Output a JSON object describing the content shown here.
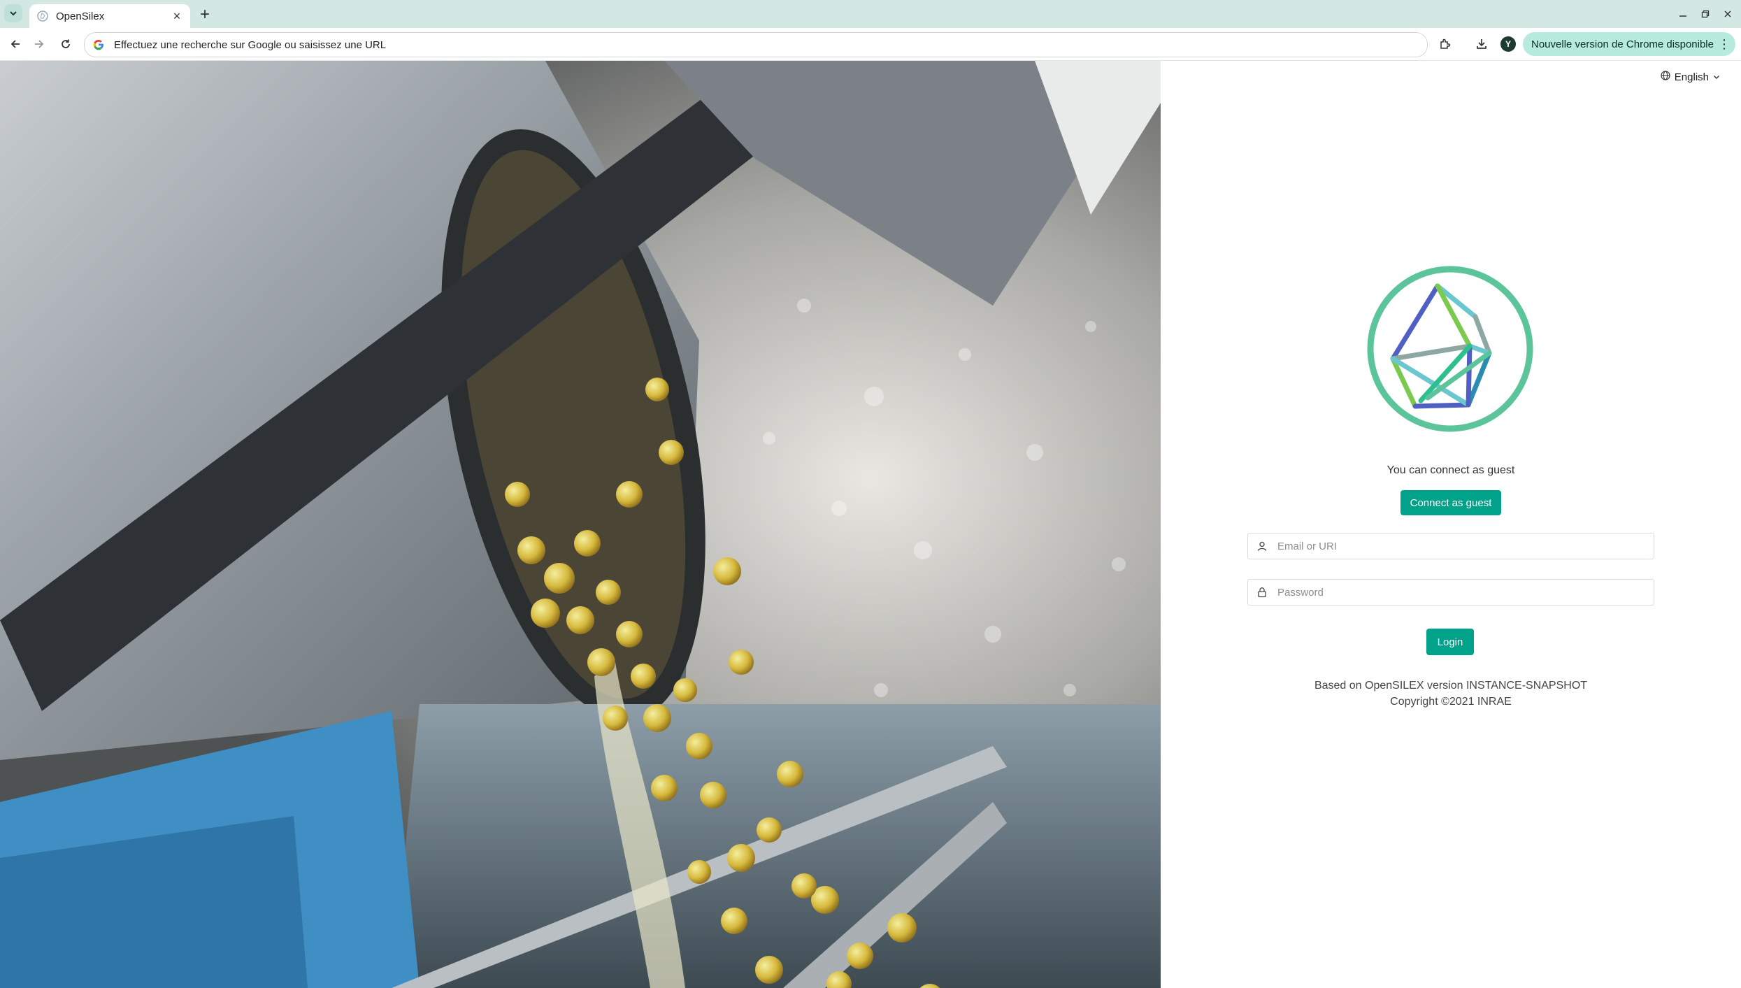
{
  "browser": {
    "tab_title": "OpenSilex",
    "tab_close": "×",
    "new_tab": "+",
    "omnibox_text": "Effectuez une recherche sur Google ou saisissez une URL",
    "profile_initial": "Y",
    "update_label": "Nouvelle version de Chrome disponible",
    "update_menu": "⋮",
    "icons": [
      "tab-search-icon",
      "favicon-icon",
      "back-icon",
      "forward-icon",
      "reload-icon",
      "google-icon",
      "extensions-icon",
      "download-icon",
      "minimize-icon",
      "maximize-icon",
      "close-window-icon"
    ]
  },
  "page": {
    "language": "English",
    "guest_text": "You can connect as guest",
    "guest_button": "Connect as guest",
    "email_placeholder": "Email or URI",
    "password_placeholder": "Password",
    "login_button": "Login",
    "footer_line1": "Based on OpenSILEX version INSTANCE-SNAPSHOT",
    "footer_line2": "Copyright ©2021 INRAE",
    "accent_color": "#00a28a",
    "photo_subject": "grapes pouring from a harvest machine"
  }
}
